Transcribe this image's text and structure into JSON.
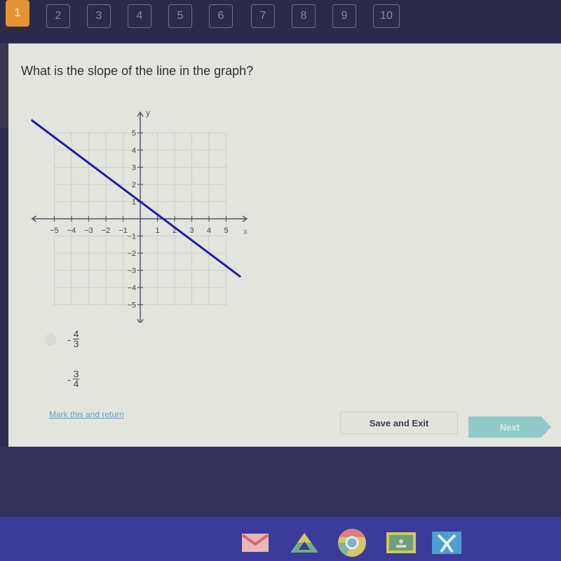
{
  "question_nav": {
    "current": "1",
    "items": [
      "1",
      "2",
      "3",
      "4",
      "5",
      "6",
      "7",
      "8",
      "9",
      "10"
    ]
  },
  "question": {
    "text": "What is the slope of the line in the graph?"
  },
  "chart_data": {
    "type": "line",
    "title": "",
    "xlabel": "x",
    "ylabel": "y",
    "xlim": [
      -5,
      5
    ],
    "ylim": [
      -5,
      5
    ],
    "grid": true,
    "x_ticks": [
      "-5",
      "-4",
      "-3",
      "-2",
      "-1",
      "1",
      "2",
      "3",
      "4",
      "5"
    ],
    "y_ticks": [
      "5",
      "4",
      "3",
      "2",
      "1",
      "-1",
      "-2",
      "-3",
      "-4",
      "-5"
    ],
    "series": [
      {
        "name": "line",
        "color": "#1f1f9e",
        "x": [
          -6.3,
          5.8
        ],
        "y": [
          5.725,
          -3.35
        ],
        "slope": -0.75,
        "y_intercept": 1
      }
    ]
  },
  "answers": [
    {
      "sign": "-",
      "numerator": "4",
      "denominator": "3"
    },
    {
      "sign": "-",
      "numerator": "3",
      "denominator": "4"
    }
  ],
  "footer": {
    "mark_link": "Mark this and return",
    "save_label": "Save and Exit",
    "next_label": "Next"
  },
  "shelf": {
    "apps": [
      "gmail-icon",
      "drive-icon",
      "chrome-icon",
      "classroom-icon",
      "app-icon"
    ]
  }
}
